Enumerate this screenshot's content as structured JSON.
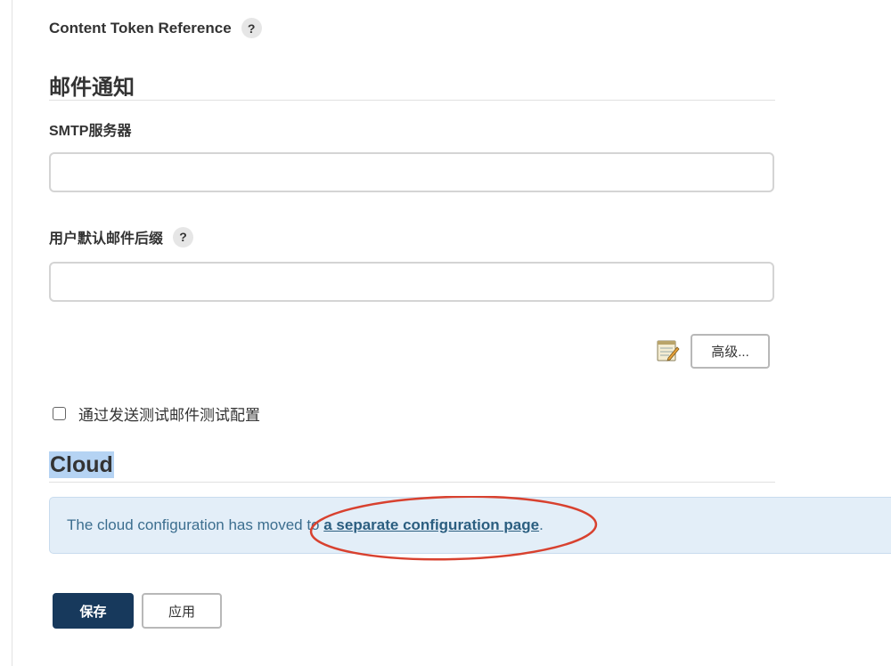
{
  "content_token": {
    "label": "Content Token Reference",
    "help": "?"
  },
  "email_section": {
    "title": "邮件通知",
    "smtp_label": "SMTP服务器",
    "smtp_value": "",
    "suffix_label": "用户默认邮件后缀",
    "suffix_help": "?",
    "suffix_value": "",
    "notepad_icon": "notepad-icon",
    "advanced_label": "高级...",
    "test_checkbox_label": "通过发送测试邮件测试配置",
    "test_checked": false
  },
  "cloud_section": {
    "title": "Cloud",
    "info_prefix": "The cloud configuration has moved to ",
    "info_link": "a separate configuration page",
    "info_suffix": ".",
    "annotation_color": "#d8412f"
  },
  "actions": {
    "save_label": "保存",
    "apply_label": "应用"
  },
  "colors": {
    "primary": "#17395c",
    "info_bg": "#e3eef8",
    "link": "#2b5e80",
    "highlight": "#b5d3f3"
  }
}
